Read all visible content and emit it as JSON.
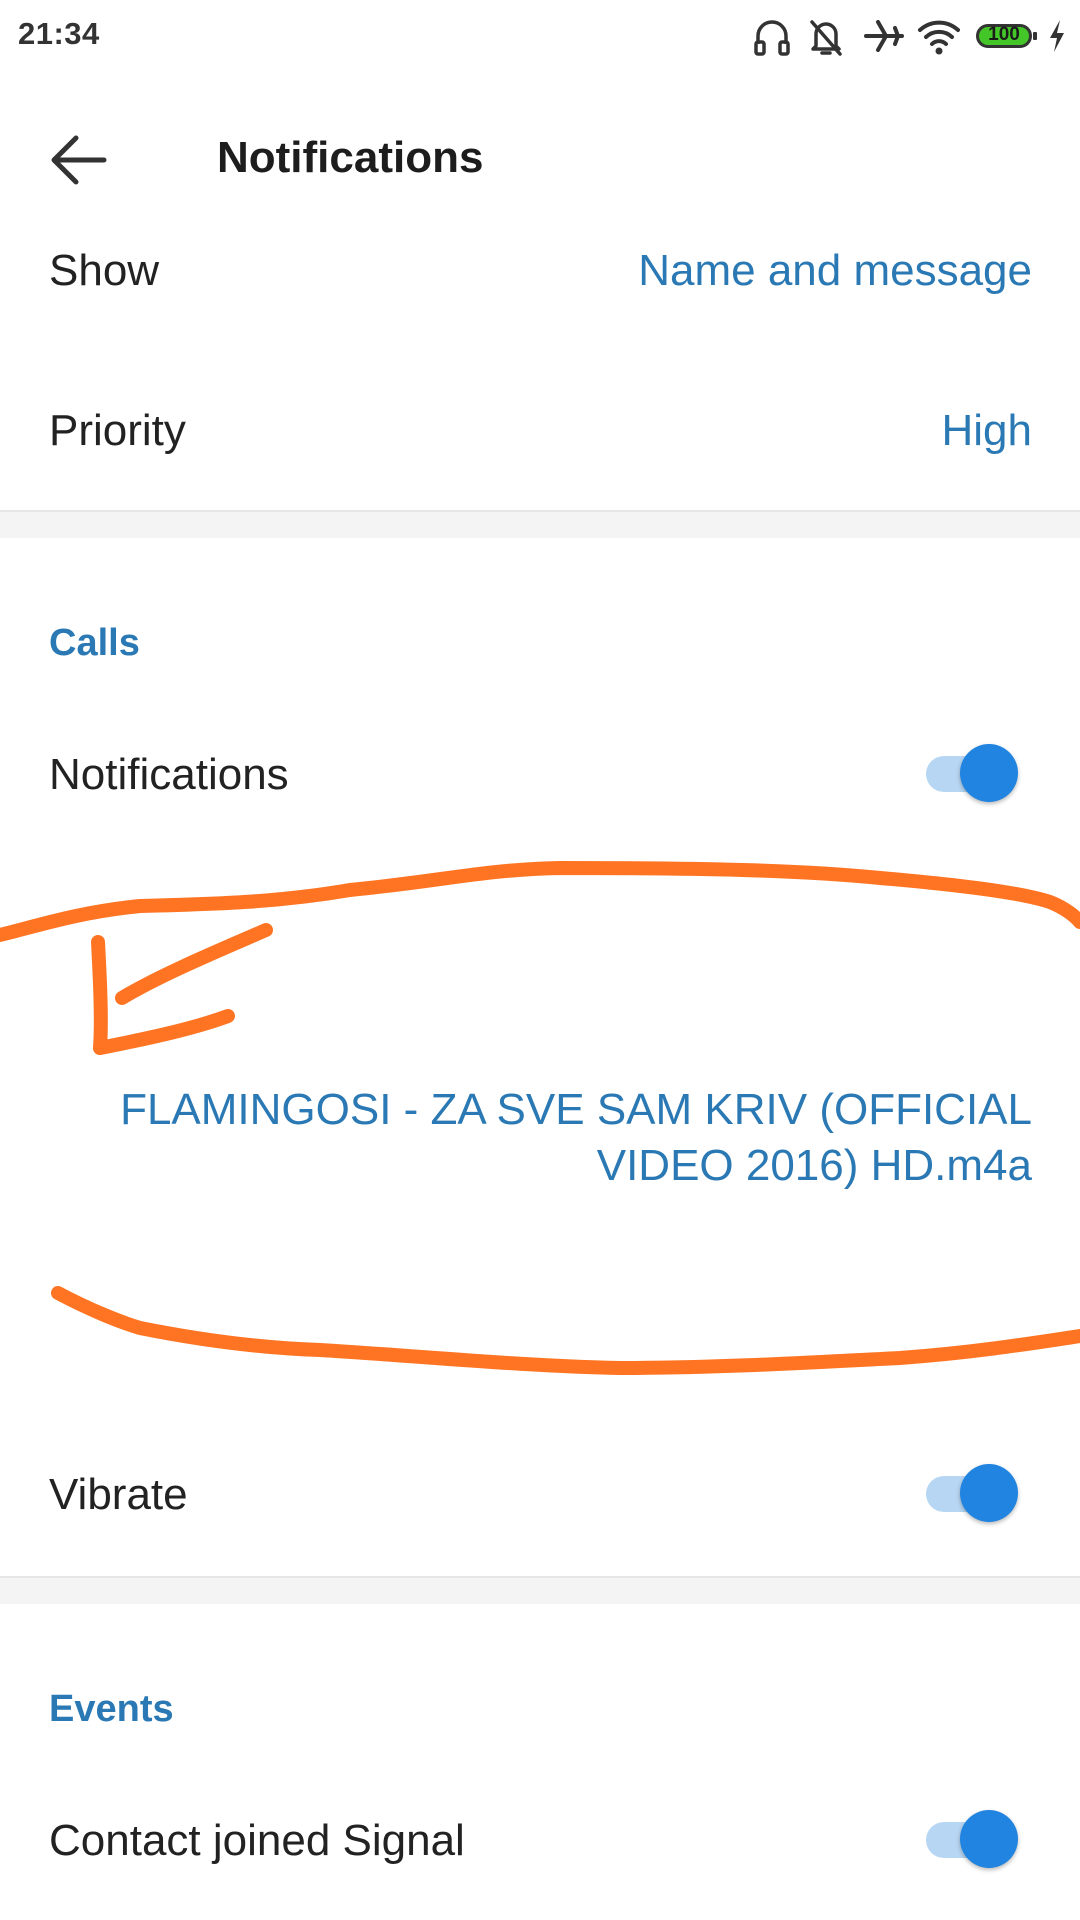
{
  "status_bar": {
    "time": "21:34",
    "battery_level": "100",
    "icons": [
      "headphones-icon",
      "bell-off-icon",
      "airplane-icon",
      "wifi-icon",
      "battery-icon",
      "charging-bolt-icon"
    ]
  },
  "toolbar": {
    "back_icon": "arrow-left-icon",
    "title": "Notifications"
  },
  "messages": {
    "show_label": "Show",
    "show_value": "Name and message",
    "priority_label": "Priority",
    "priority_value": "High"
  },
  "calls": {
    "header": "Calls",
    "notifications_label": "Notifications",
    "notifications_enabled": true,
    "ringtone_value": "FLAMINGOSI - ZA SVE SAM KRIV (OFFICIAL VIDEO 2016) HD.m4a",
    "vibrate_label": "Vibrate",
    "vibrate_enabled": true
  },
  "events": {
    "header": "Events",
    "contact_joined_label": "Contact joined Signal",
    "contact_joined_enabled": true
  },
  "colors": {
    "accent": "#2a79b4",
    "toggle_thumb": "#2184e0",
    "toggle_track": "#b7d6f3",
    "annotation": "#ff7422"
  }
}
